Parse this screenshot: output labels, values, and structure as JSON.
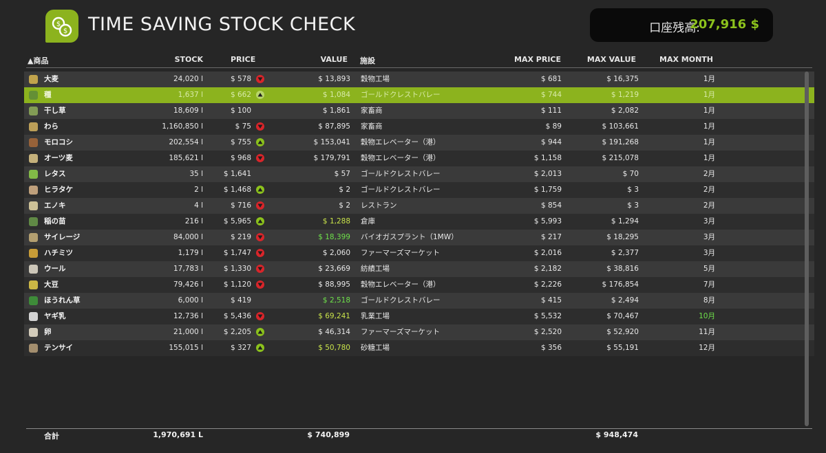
{
  "app": {
    "title": "TIME SAVING STOCK CHECK"
  },
  "balance": {
    "label": "口座残高:",
    "value": "207,916 $"
  },
  "colors": {
    "accent": "#8cb31e",
    "up": "#8cc21c",
    "down": "#d9252a"
  },
  "table": {
    "headers": {
      "name": "▲商品",
      "stock": "STOCK",
      "price": "PRICE",
      "value": "VALUE",
      "facility": "施設",
      "max_price": "MAX PRICE",
      "max_value": "MAX VALUE",
      "max_month": "MAX MONTH"
    },
    "rows": [
      {
        "icon": "wheat-icon",
        "name": "大麦",
        "stock": "24,020 l",
        "price": "$ 578",
        "trend": "down",
        "value": "$ 13,893",
        "facility": "穀物工場",
        "max_price": "$ 681",
        "max_value": "$ 16,375",
        "max_month": "1月"
      },
      {
        "icon": "seed-bag-icon",
        "name": "種",
        "stock": "1,637 l",
        "price": "$ 662",
        "trend": "up",
        "value": "$ 1,084",
        "facility": "ゴールドクレストバレー",
        "max_price": "$ 744",
        "max_value": "$ 1,219",
        "max_month": "1月",
        "selected": true
      },
      {
        "icon": "hay-icon",
        "name": "干し草",
        "stock": "18,609 l",
        "price": "$ 100",
        "trend": "none",
        "value": "$ 1,861",
        "facility": "家畜商",
        "max_price": "$ 111",
        "max_value": "$ 2,082",
        "max_month": "1月"
      },
      {
        "icon": "straw-icon",
        "name": "わら",
        "stock": "1,160,850 l",
        "price": "$ 75",
        "trend": "down",
        "value": "$ 87,895",
        "facility": "家畜商",
        "max_price": "$ 89",
        "max_value": "$ 103,661",
        "max_month": "1月"
      },
      {
        "icon": "sorghum-icon",
        "name": "モロコシ",
        "stock": "202,554 l",
        "price": "$ 755",
        "trend": "up",
        "value": "$ 153,041",
        "facility": "穀物エレベーター（港）",
        "max_price": "$ 944",
        "max_value": "$ 191,268",
        "max_month": "1月"
      },
      {
        "icon": "oat-icon",
        "name": "オーツ麦",
        "stock": "185,621 l",
        "price": "$ 968",
        "trend": "down",
        "value": "$ 179,791",
        "facility": "穀物エレベーター（港）",
        "max_price": "$ 1,158",
        "max_value": "$ 215,078",
        "max_month": "1月"
      },
      {
        "icon": "lettuce-icon",
        "name": "レタス",
        "stock": "35 l",
        "price": "$ 1,641",
        "trend": "none",
        "value": "$ 57",
        "facility": "ゴールドクレストバレー",
        "max_price": "$ 2,013",
        "max_value": "$ 70",
        "max_month": "2月"
      },
      {
        "icon": "mushroom-icon",
        "name": "ヒラタケ",
        "stock": "2 l",
        "price": "$ 1,468",
        "trend": "up",
        "value": "$ 2",
        "facility": "ゴールドクレストバレー",
        "max_price": "$ 1,759",
        "max_value": "$ 3",
        "max_month": "2月"
      },
      {
        "icon": "enoki-icon",
        "name": "エノキ",
        "stock": "4 l",
        "price": "$ 716",
        "trend": "down",
        "value": "$ 2",
        "facility": "レストラン",
        "max_price": "$ 854",
        "max_value": "$ 3",
        "max_month": "2月"
      },
      {
        "icon": "seedling-icon",
        "name": "稲の苗",
        "stock": "216 l",
        "price": "$ 5,965",
        "trend": "up",
        "value": "$ 1,288",
        "value_color": "yellow",
        "facility": "倉庫",
        "max_price": "$ 5,993",
        "max_value": "$ 1,294",
        "max_month": "3月"
      },
      {
        "icon": "silage-icon",
        "name": "サイレージ",
        "stock": "84,000 l",
        "price": "$ 219",
        "trend": "down",
        "value": "$ 18,399",
        "value_color": "green",
        "facility": "バイオガスプラント（1MW）",
        "max_price": "$ 217",
        "max_value": "$ 18,295",
        "max_month": "3月"
      },
      {
        "icon": "honey-icon",
        "name": "ハチミツ",
        "stock": "1,179 l",
        "price": "$ 1,747",
        "trend": "down",
        "value": "$ 2,060",
        "facility": "ファーマーズマーケット",
        "max_price": "$ 2,016",
        "max_value": "$ 2,377",
        "max_month": "3月"
      },
      {
        "icon": "wool-icon",
        "name": "ウール",
        "stock": "17,783 l",
        "price": "$ 1,330",
        "trend": "down",
        "value": "$ 23,669",
        "facility": "紡績工場",
        "max_price": "$ 2,182",
        "max_value": "$ 38,816",
        "max_month": "5月"
      },
      {
        "icon": "soybean-icon",
        "name": "大豆",
        "stock": "79,426 l",
        "price": "$ 1,120",
        "trend": "down",
        "value": "$ 88,995",
        "facility": "穀物エレベーター（港）",
        "max_price": "$ 2,226",
        "max_value": "$ 176,854",
        "max_month": "7月"
      },
      {
        "icon": "spinach-icon",
        "name": "ほうれん草",
        "stock": "6,000 l",
        "price": "$ 419",
        "trend": "none",
        "value": "$ 2,518",
        "value_color": "green",
        "facility": "ゴールドクレストバレー",
        "max_price": "$ 415",
        "max_value": "$ 2,494",
        "max_month": "8月"
      },
      {
        "icon": "goat-milk-icon",
        "name": "ヤギ乳",
        "stock": "12,736 l",
        "price": "$ 5,436",
        "trend": "down",
        "value": "$ 69,241",
        "value_color": "yellow",
        "facility": "乳業工場",
        "max_price": "$ 5,532",
        "max_value": "$ 70,467",
        "max_month": "10月",
        "max_month_color": "green"
      },
      {
        "icon": "egg-icon",
        "name": "卵",
        "stock": "21,000 l",
        "price": "$ 2,205",
        "trend": "up",
        "value": "$ 46,314",
        "facility": "ファーマーズマーケット",
        "max_price": "$ 2,520",
        "max_value": "$ 52,920",
        "max_month": "11月"
      },
      {
        "icon": "sugar-beet-icon",
        "name": "テンサイ",
        "stock": "155,015 l",
        "price": "$ 327",
        "trend": "up",
        "value": "$ 50,780",
        "value_color": "yellow",
        "facility": "砂糖工場",
        "max_price": "$ 356",
        "max_value": "$ 55,191",
        "max_month": "12月"
      }
    ]
  },
  "footer": {
    "label": "合計",
    "stock_total": "1,970,691 L",
    "value_total": "$ 740,899",
    "max_value_total": "$ 948,474"
  }
}
